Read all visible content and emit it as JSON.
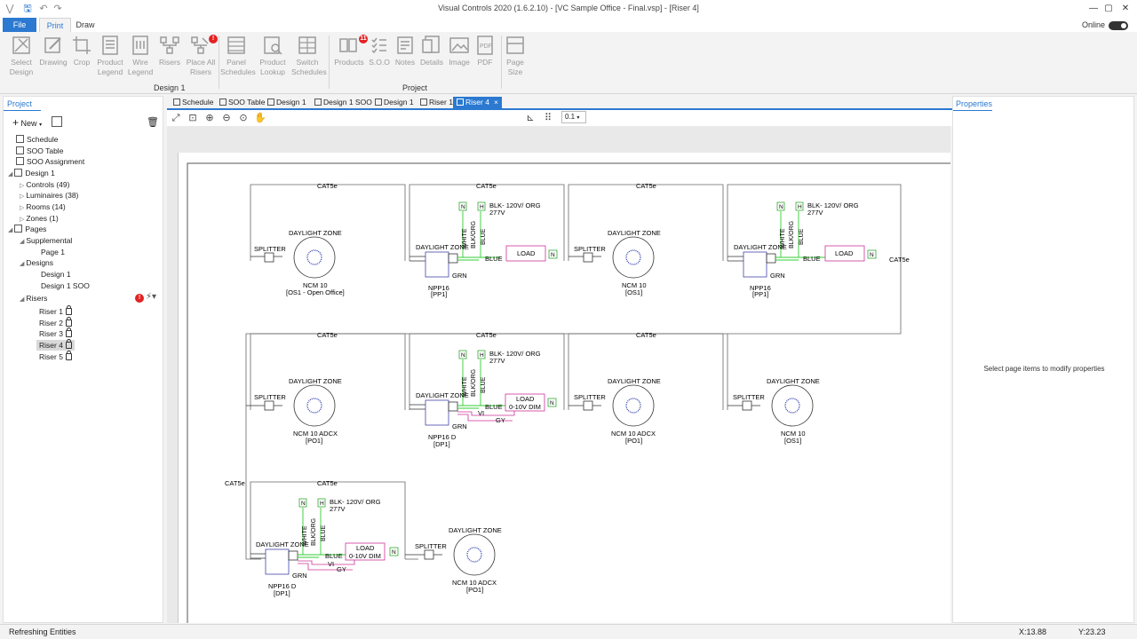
{
  "window": {
    "title": "Visual Controls 2020 (1.6.2.10) - [VC Sample Office - Final.vsp] - [Riser 4]"
  },
  "ribbon_tabs": {
    "file": "File",
    "print": "Print",
    "draw": "Draw"
  },
  "online": {
    "label": "Online"
  },
  "ribbon": {
    "groups": {
      "design": "Design 1",
      "project": "Project"
    },
    "buttons": {
      "select_design": "Select Design",
      "drawing": "Drawing",
      "crop": "Crop",
      "product_legend": "Product Legend",
      "wire_legend": "Wire Legend",
      "risers": "Risers",
      "place_all_risers": "Place All Risers",
      "panel_schedules": "Panel Schedules",
      "product_lookup": "Product Lookup",
      "switch_schedules": "Switch Schedules",
      "products": "Products",
      "soo": "S.O.O",
      "notes": "Notes",
      "details": "Details",
      "image": "Image",
      "pdf": "PDF",
      "page_size": "Page Size"
    },
    "products_badge": "11"
  },
  "project_panel": {
    "header": "Project",
    "new_label": "New",
    "tree": {
      "schedule": "Schedule",
      "soo_table": "SOO Table",
      "soo_assignment": "SOO Assignment",
      "design1": "Design 1",
      "controls": "Controls (49)",
      "luminaires": "Luminaires (38)",
      "rooms": "Rooms (14)",
      "zones": "Zones (1)",
      "pages": "Pages",
      "supplemental": "Supplemental",
      "page1": "Page 1",
      "designs": "Designs",
      "designs_design1": "Design 1",
      "designs_design1_soo": "Design 1 SOO",
      "risers": "Risers",
      "riser_items": [
        "Riser 1",
        "Riser 2",
        "Riser 3",
        "Riser 4",
        "Riser 5"
      ]
    }
  },
  "doc_tabs": [
    "Schedule",
    "SOO Table",
    "Design 1",
    "Design 1 SOO",
    "Design 1",
    "Riser 1",
    "Riser 4"
  ],
  "canvas_toolbar": {
    "zoom_value": "0.1"
  },
  "riser": {
    "cat5e": "CAT5e",
    "splitter": "SPLITTER",
    "daylight_zone": "DAYLIGHT ZONE",
    "load": "LOAD",
    "dim": "0-10V  DIM",
    "blue": "BLUE",
    "grn": "GRN",
    "white": "WHITE",
    "blkorg": "BLK/ORG",
    "n": "N",
    "h": "H",
    "vi": "VI",
    "gy": "GY",
    "blk120": "BLK- 120V/ ORG",
    "v277": "277V",
    "ncm10": "NCM 10",
    "ncm10adcx": "NCM 10 ADCX",
    "npp16": "NPP16",
    "npp16d": "NPP16 D",
    "os1_open": "[OS1 - Open Office]",
    "os1": "[OS1]",
    "pp1": "[PP1]",
    "po1": "[PO1]",
    "dp1": "[DP1]"
  },
  "properties_panel": {
    "header": "Properties",
    "empty_message": "Select page items to modify properties"
  },
  "status": {
    "left": "Refreshing Entities",
    "x": "X:13.88",
    "y": "Y:23.23"
  }
}
